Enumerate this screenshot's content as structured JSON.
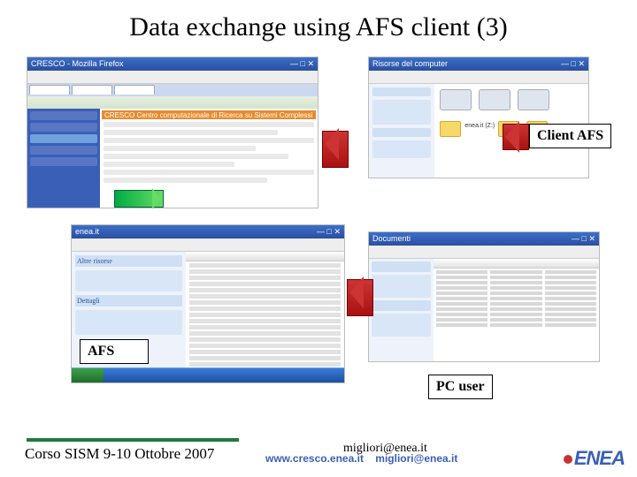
{
  "title": "Data exchange using AFS client (3)",
  "labels": {
    "client_afs": "Client AFS",
    "afs": "AFS",
    "pc_user": "PC user"
  },
  "screenshots": {
    "browser": {
      "window_title": "CRESCO - Mozilla Firefox",
      "headline": "CRESCO Centro computazionale di Ricerca su Sistemi Complessi"
    },
    "my_computer": {
      "window_title": "Risorse del computer",
      "afs_label": "enea.it (Z:)"
    },
    "afs_explorer": {
      "window_title": "enea.it",
      "panel": "Altre risorse",
      "panel2": "Dettagli"
    },
    "docs": {
      "window_title": "Documenti"
    }
  },
  "footer": {
    "left": "Corso SISM  9-10 Ottobre 2007",
    "url": "www.cresco.enea.it",
    "email1": "migliori@enea.it",
    "email2": "migliori@enea.it",
    "logo": "ENEA"
  }
}
